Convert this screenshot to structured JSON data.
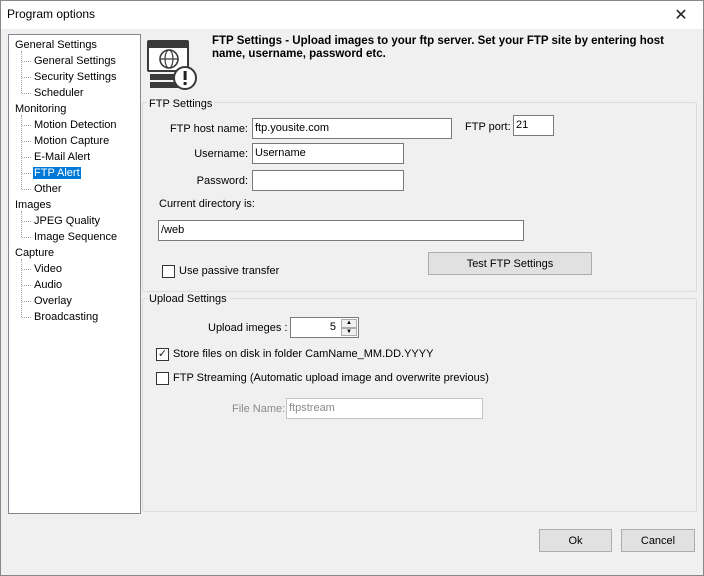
{
  "window": {
    "title": "Program options",
    "close_glyph": "✕"
  },
  "tree": [
    {
      "label": "General Settings",
      "level": 0
    },
    {
      "label": "General Settings",
      "level": 1
    },
    {
      "label": "Security Settings",
      "level": 1
    },
    {
      "label": "Scheduler",
      "level": 1
    },
    {
      "label": "Monitoring",
      "level": 0
    },
    {
      "label": "Motion Detection",
      "level": 1
    },
    {
      "label": "Motion Capture",
      "level": 1
    },
    {
      "label": "E-Mail Alert",
      "level": 1
    },
    {
      "label": "FTP Alert",
      "level": 1,
      "selected": true
    },
    {
      "label": "Other",
      "level": 1
    },
    {
      "label": "Images",
      "level": 0
    },
    {
      "label": "JPEG Quality",
      "level": 1
    },
    {
      "label": "Image Sequence",
      "level": 1
    },
    {
      "label": "Capture",
      "level": 0
    },
    {
      "label": "Video",
      "level": 1
    },
    {
      "label": "Audio",
      "level": 1
    },
    {
      "label": "Overlay",
      "level": 1
    },
    {
      "label": "Broadcasting",
      "level": 1
    }
  ],
  "header": {
    "icon": "ftp-server-warning-icon",
    "text": "FTP Settings - Upload images to your ftp server. Set your FTP site by entering host name, username, password etc."
  },
  "ftp": {
    "group_label": "FTP Settings",
    "host_label": "FTP host name:",
    "host_value": "ftp.yousite.com",
    "port_label": "FTP port:",
    "port_value": "21",
    "username_label": "Username:",
    "username_value": "Username",
    "password_label": "Password:",
    "password_value": "",
    "dir_label": "Current directory is:",
    "dir_value": "/web",
    "passive_label": "Use passive transfer",
    "passive_checked": false,
    "test_button": "Test FTP Settings"
  },
  "upload": {
    "group_label": "Upload Settings",
    "images_label": "Upload imeges :",
    "images_value": "5",
    "store_label": "Store files on disk in folder CamName_MM.DD.YYYY",
    "store_checked": true,
    "streaming_label": "FTP Streaming  (Automatic upload image and overwrite previous)",
    "streaming_checked": false,
    "filename_label": "File Name:",
    "filename_value": "ftpstream"
  },
  "footer": {
    "ok": "Ok",
    "cancel": "Cancel"
  },
  "colors": {
    "selection": "#0078d7",
    "dialog_bg": "#f0f0f0"
  }
}
